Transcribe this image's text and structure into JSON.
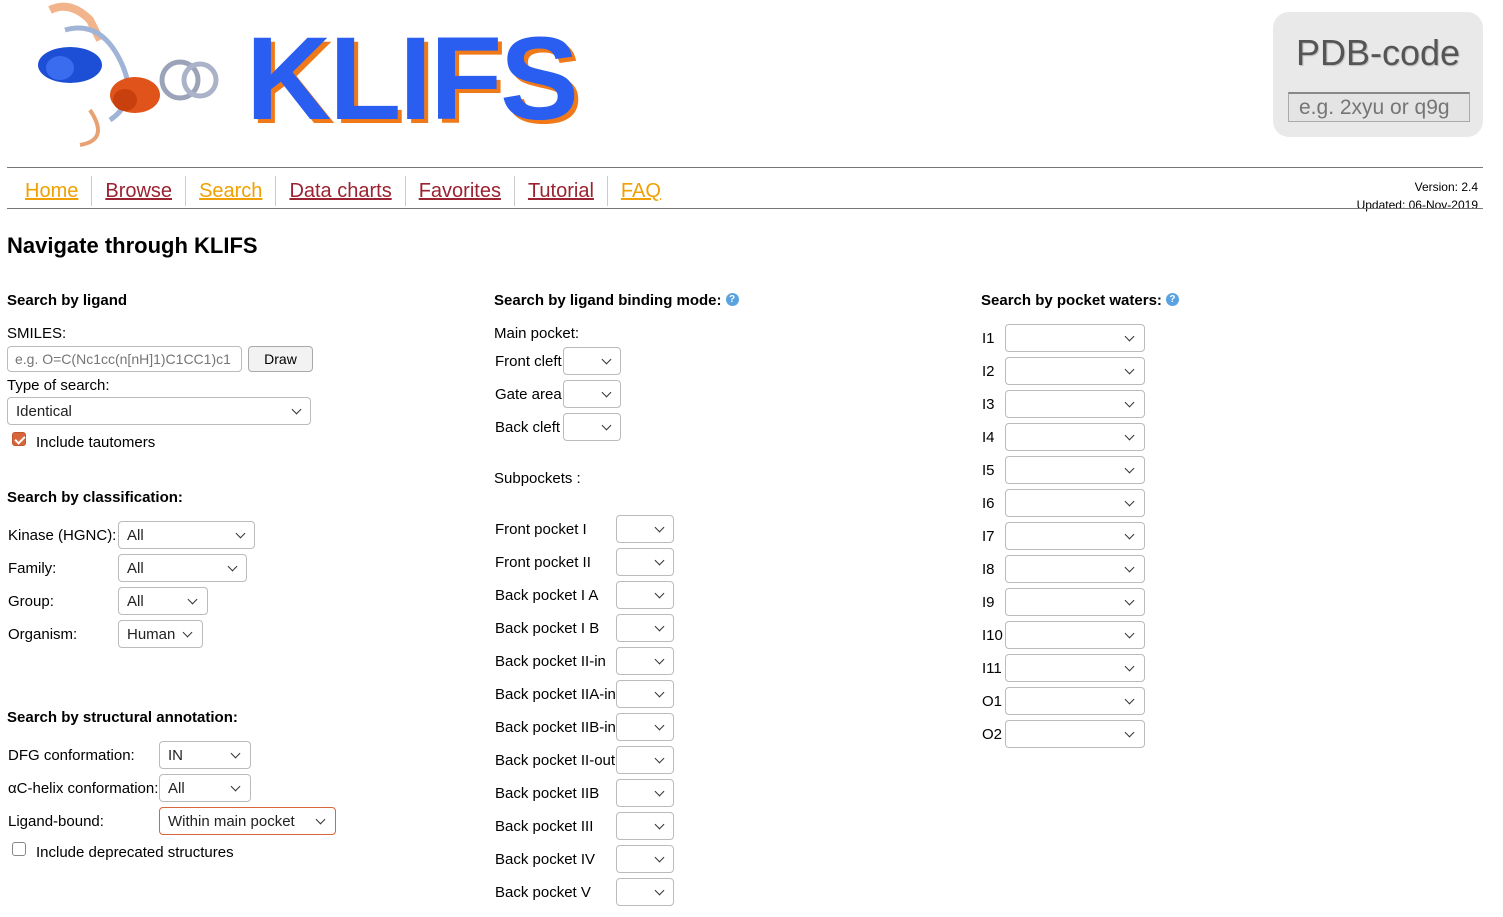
{
  "header": {
    "logo_text": "KLIFS",
    "pdb_title": "PDB-code",
    "pdb_placeholder": "e.g. 2xyu or q9g"
  },
  "nav": [
    {
      "label": "Home",
      "color": "orange"
    },
    {
      "label": "Browse",
      "color": "red"
    },
    {
      "label": "Search",
      "color": "orange"
    },
    {
      "label": "Data charts",
      "color": "red"
    },
    {
      "label": "Favorites",
      "color": "red"
    },
    {
      "label": "Tutorial",
      "color": "red"
    },
    {
      "label": "FAQ",
      "color": "orange"
    }
  ],
  "version": {
    "version": "Version: 2.4",
    "updated": "Updated: 06-Nov-2019"
  },
  "page_title": "Navigate through KLIFS",
  "ligand": {
    "heading": "Search by ligand",
    "smiles_label": "SMILES:",
    "smiles_placeholder": "e.g. O=C(Nc1cc(n[nH]1)C1CC1)c1",
    "draw_label": "Draw",
    "type_label": "Type of search:",
    "type_value": "Identical",
    "tautomers_label": "Include tautomers",
    "tautomers_checked": true
  },
  "classification": {
    "heading": "Search by classification:",
    "kinase_label": "Kinase (HGNC):",
    "kinase_value": "All",
    "family_label": "Family:",
    "family_value": "All",
    "group_label": "Group:",
    "group_value": "All",
    "organism_label": "Organism:",
    "organism_value": "Human"
  },
  "structural": {
    "heading": "Search by structural annotation:",
    "dfg_label": "DFG conformation:",
    "dfg_value": "IN",
    "ac_label": "C-helix conformation:",
    "ac_prefix": "α",
    "ac_value": "All",
    "ligand_bound_label": "Ligand-bound:",
    "ligand_bound_value": "Within main pocket",
    "deprecated_label": "Include deprecated structures",
    "deprecated_checked": false
  },
  "binding_mode": {
    "heading": "Search by ligand binding mode:",
    "main_pocket_label": "Main pocket:",
    "main_pocket": [
      "Front cleft",
      "Gate area",
      "Back cleft"
    ],
    "subpockets_label": "Subpockets :",
    "subpockets": [
      "Front pocket I",
      "Front pocket II",
      "Back pocket I A",
      "Back pocket I B",
      "Back pocket II-in",
      "Back pocket IIA-in",
      "Back pocket IIB-in",
      "Back pocket II-out",
      "Back pocket IIB",
      "Back pocket III",
      "Back pocket IV",
      "Back pocket V"
    ]
  },
  "waters": {
    "heading": "Search by pocket waters:",
    "items": [
      "I1",
      "I2",
      "I3",
      "I4",
      "I5",
      "I6",
      "I7",
      "I8",
      "I9",
      "I10",
      "I11",
      "O1",
      "O2"
    ]
  },
  "colors": {
    "accent_orange": "#f0a000",
    "link_red": "#9b2230",
    "logo_blue": "#2a5ef0",
    "logo_shadow": "#f07a1a",
    "help_blue": "#5aa3e0"
  }
}
